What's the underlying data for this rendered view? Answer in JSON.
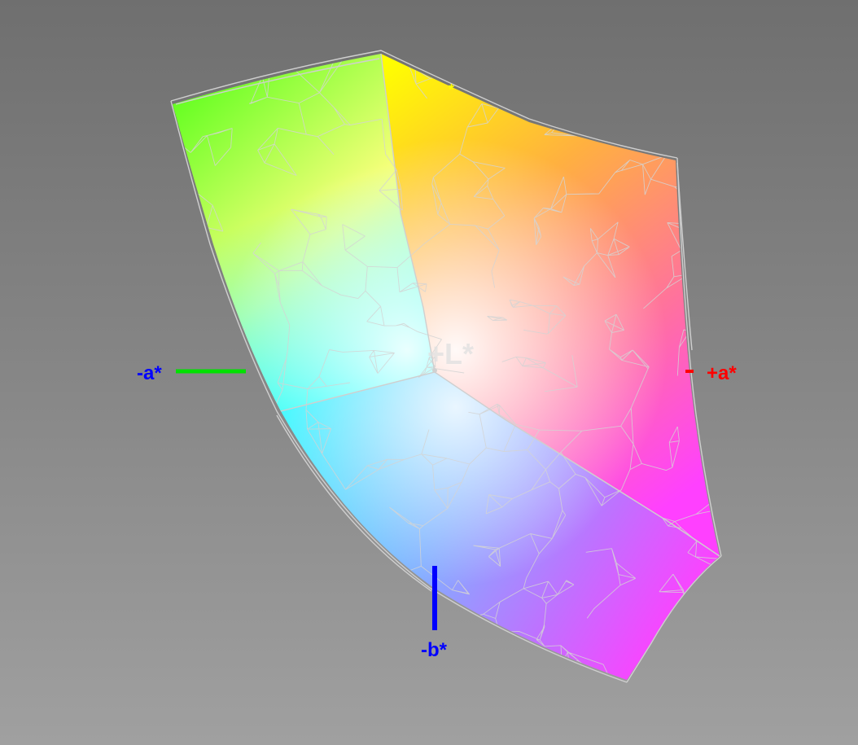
{
  "axes": {
    "neg_a": {
      "label": "-a*",
      "line_color": "#00e000",
      "label_color": "#0000ff"
    },
    "pos_a": {
      "label": "+a*",
      "line_color": "#ff0000",
      "label_color": "#ff0000"
    },
    "neg_b": {
      "label": "-b*",
      "line_color": "#0000ff",
      "label_color": "#0000ff"
    },
    "pos_l": {
      "label": "+L*",
      "label_color": "#e0e0e0"
    },
    "pos_b": {
      "label": "*",
      "label_color": "#ffff00"
    }
  },
  "colors": {
    "green": "#66ff22",
    "yellow": "#ffff00",
    "orange": "#ff7a1a",
    "red": "#ff3a3a",
    "magenta": "#ff40ff",
    "violet": "#a040ff",
    "blue": "#6aa0ff",
    "cyan": "#00ffff",
    "white": "#ffffff",
    "mesh": "#d4d4d4"
  }
}
